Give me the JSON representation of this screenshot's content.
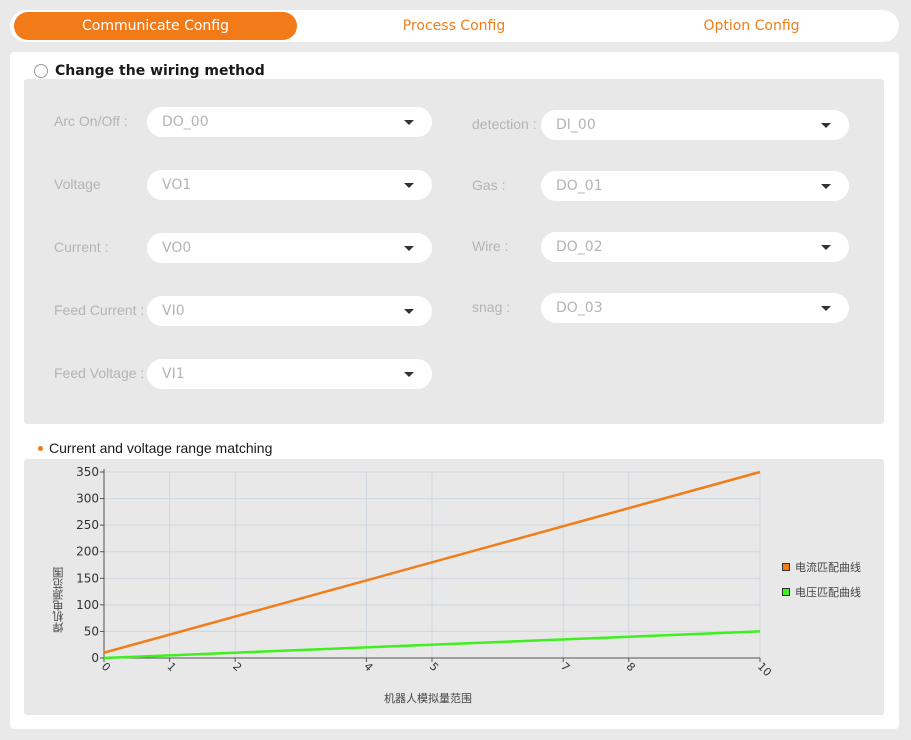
{
  "tabs": [
    {
      "label": "Communicate Config",
      "active": true
    },
    {
      "label": "Process Config",
      "active": false
    },
    {
      "label": "Option Config",
      "active": false
    }
  ],
  "wiring": {
    "label": "Change the wiring method"
  },
  "fields_left": [
    {
      "label": "Arc On/Off :",
      "value": "DO_00"
    },
    {
      "label": "Voltage",
      "value": "VO1"
    },
    {
      "label": "Current :",
      "value": "VO0"
    },
    {
      "label": "Feed Current :",
      "value": "VI0"
    },
    {
      "label": "Feed Voltage :",
      "value": "VI1"
    }
  ],
  "fields_right": [
    {
      "label": "detection :",
      "value": "DI_00"
    },
    {
      "label": "Gas :",
      "value": "DO_01"
    },
    {
      "label": "Wire :",
      "value": "DO_02"
    },
    {
      "label": "snag :",
      "value": "DO_03"
    }
  ],
  "section": {
    "title": "Current and voltage range matching"
  },
  "colors": {
    "accent": "#f37a19",
    "current_line": "#f07d1a",
    "voltage_line": "#3ef01c"
  },
  "chart_data": {
    "type": "line",
    "xlabel": "机器人模拟量范围",
    "ylabel": "焊机电源范围",
    "x": [
      0,
      1,
      2,
      4,
      5,
      7,
      8,
      10
    ],
    "xlim": [
      0,
      10
    ],
    "ylim": [
      0,
      350
    ],
    "yticks": [
      0,
      50,
      100,
      150,
      200,
      250,
      300,
      350
    ],
    "grid": true,
    "legend_position": "right",
    "series": [
      {
        "name": "电流匹配曲线",
        "color": "#f07d1a",
        "x": [
          0,
          10
        ],
        "y": [
          10,
          350
        ]
      },
      {
        "name": "电压匹配曲线",
        "color": "#3ef01c",
        "x": [
          0,
          10
        ],
        "y": [
          0,
          50
        ]
      }
    ]
  }
}
